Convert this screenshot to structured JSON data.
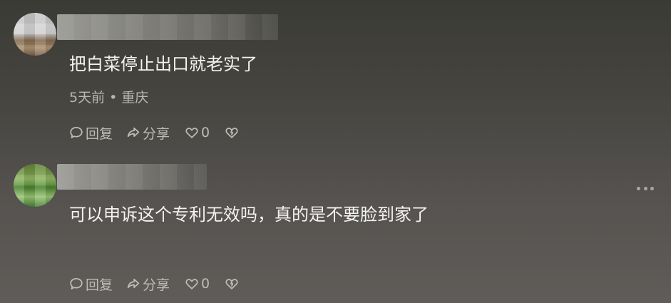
{
  "comments": [
    {
      "username": "",
      "text": "把白菜停止出口就老实了",
      "time": "5天前",
      "location": "重庆",
      "reply_label": "回复",
      "share_label": "分享",
      "like_count": "0"
    },
    {
      "username": "",
      "text": "可以申诉这个专利无效吗，真的是不要脸到家了",
      "reply_label": "回复",
      "share_label": "分享",
      "like_count": "0"
    }
  ],
  "icons": {
    "reply": "speech-bubble-icon",
    "share": "share-arrow-icon",
    "like": "heart-outline-icon",
    "dislike": "broken-heart-icon",
    "more": "more-dots-icon"
  },
  "colors": {
    "text": "#f3f3f0",
    "secondary_text": "#b9b8b3",
    "icon": "#bdbcb7"
  }
}
